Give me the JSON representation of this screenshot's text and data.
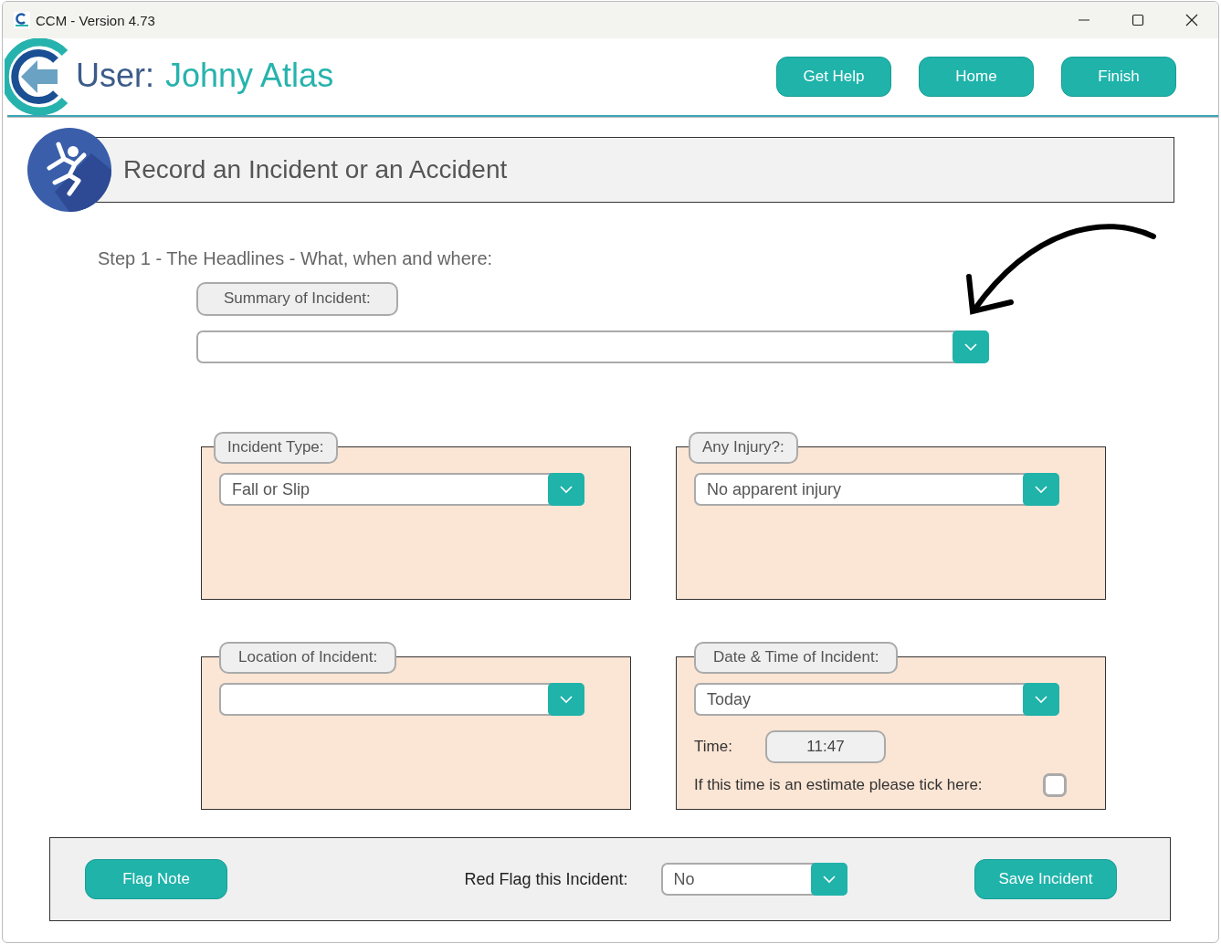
{
  "window": {
    "title": "CCM - Version 4.73"
  },
  "header": {
    "user_label": "User:",
    "user_name": "Johny Atlas",
    "buttons": [
      "Get Help",
      "Home",
      "Finish"
    ]
  },
  "page_title": "Record an Incident or an Accident",
  "step_heading": "Step 1 - The Headlines - What, when and where:",
  "summary": {
    "label": "Summary of Incident:"
  },
  "panels": [
    {
      "kind": "dropdown",
      "label": "Incident Type:",
      "value": "Fall or Slip"
    },
    {
      "kind": "dropdown",
      "label": "Any Injury?:",
      "value": "No apparent injury"
    },
    {
      "kind": "dropdown",
      "label": "Location of Incident:"
    },
    {
      "kind": "datetime",
      "label": "Date & Time of Incident:",
      "value": "Today",
      "time_label": "Time:",
      "time": "11:47",
      "estimate_label": "If this time is an estimate please tick here:",
      "estimate_checked": false
    }
  ],
  "footer": {
    "flag_button": "Flag Note",
    "red_flag_label": "Red Flag this Incident:",
    "red_flag_value": "No",
    "save_button": "Save Incident"
  }
}
